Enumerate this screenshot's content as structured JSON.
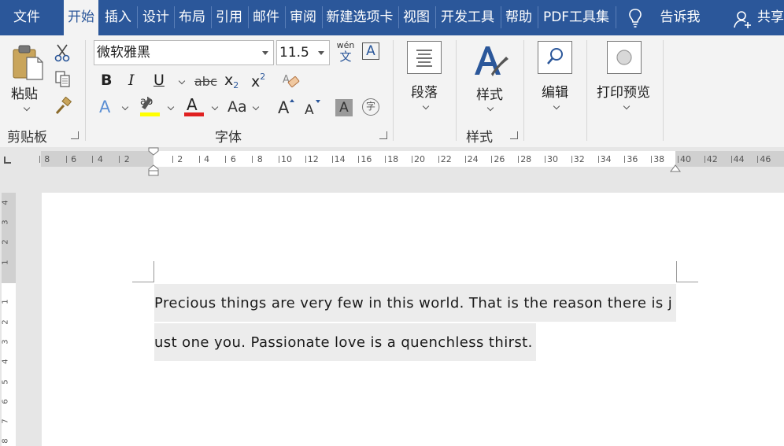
{
  "tabs": [
    {
      "label": "文件",
      "active": false
    },
    {
      "label": "开始",
      "active": true
    },
    {
      "label": "插入",
      "active": false
    },
    {
      "label": "设计",
      "active": false
    },
    {
      "label": "布局",
      "active": false
    },
    {
      "label": "引用",
      "active": false
    },
    {
      "label": "邮件",
      "active": false
    },
    {
      "label": "审阅",
      "active": false
    },
    {
      "label": "新建选项卡",
      "active": false
    },
    {
      "label": "视图",
      "active": false
    },
    {
      "label": "开发工具",
      "active": false
    },
    {
      "label": "帮助",
      "active": false
    },
    {
      "label": "PDF工具集",
      "active": false
    }
  ],
  "tell_me": "告诉我",
  "share": "共享",
  "clipboard": {
    "paste_label": "粘贴",
    "group_label": "剪贴板"
  },
  "font": {
    "name": "微软雅黑",
    "size": "11.5",
    "group_label": "字体",
    "wen_top": "wén",
    "wen_bottom": "文",
    "border_letter": "A",
    "bold": "B",
    "italic": "I",
    "underline": "U",
    "strike": "abc",
    "subscript": "x",
    "sub2": "2",
    "superscript": "x",
    "sup2": "2",
    "text_effect": "A",
    "highlight": "ab",
    "font_color": "A",
    "change_case": "Aa",
    "grow": "A",
    "shrink": "A",
    "shading": "A",
    "enclose": "字",
    "highlight_color": "#ffff00",
    "font_color_bar": "#e02020"
  },
  "paragraph": {
    "label": "段落"
  },
  "styles": {
    "label": "样式",
    "group_label": "样式"
  },
  "editing": {
    "label": "编辑"
  },
  "print_preview": {
    "label": "打印预览"
  },
  "ruler": {
    "h_left": [
      "8",
      "6",
      "4",
      "2"
    ],
    "h_right": [
      "2",
      "4",
      "6",
      "8",
      "10",
      "12",
      "14",
      "16",
      "18",
      "20",
      "22",
      "24",
      "26",
      "28",
      "30",
      "32",
      "34",
      "36",
      "38",
      "40",
      "42",
      "44",
      "46"
    ],
    "v_top": [
      "4",
      "3",
      "2",
      "1"
    ],
    "v_bottom": [
      "1",
      "2",
      "3",
      "4",
      "5",
      "6",
      "7",
      "8"
    ]
  },
  "document": {
    "line1": "Precious things are very few in this world. That is the reason there is j",
    "line2": "ust one you. Passionate love is a quenchless thirst."
  }
}
